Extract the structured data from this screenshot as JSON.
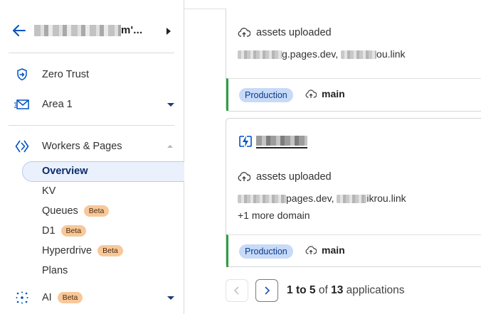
{
  "account": {
    "name_visible_tail": "m'..."
  },
  "nav": {
    "zero_trust": "Zero Trust",
    "area1": "Area 1",
    "workers_pages": "Workers & Pages",
    "sub": {
      "overview": "Overview",
      "kv": "KV",
      "queues": "Queues",
      "d1": "D1",
      "hyperdrive": "Hyperdrive",
      "plans": "Plans"
    },
    "ai": "AI",
    "beta_label": "Beta"
  },
  "cards": [
    {
      "status": "assets uploaded",
      "domains_visible_a": "g.pages.dev, ",
      "domains_visible_b": "ou.link",
      "environment": "Production",
      "branch": "main"
    },
    {
      "status": "assets uploaded",
      "domains_visible_a": "pages.dev, ",
      "domains_visible_b": "ikrou.link",
      "more_domains": "+1 more domain",
      "environment": "Production",
      "branch": "main"
    }
  ],
  "pagination": {
    "range_start": "1",
    "to": "to",
    "range_end": "5",
    "of": "of",
    "total": "13",
    "suffix": "applications"
  },
  "colors": {
    "accent": "#0051c3",
    "production_pill": "#c7daf7",
    "beta_badge": "#f8c89a",
    "success_bar": "#2ea043"
  }
}
